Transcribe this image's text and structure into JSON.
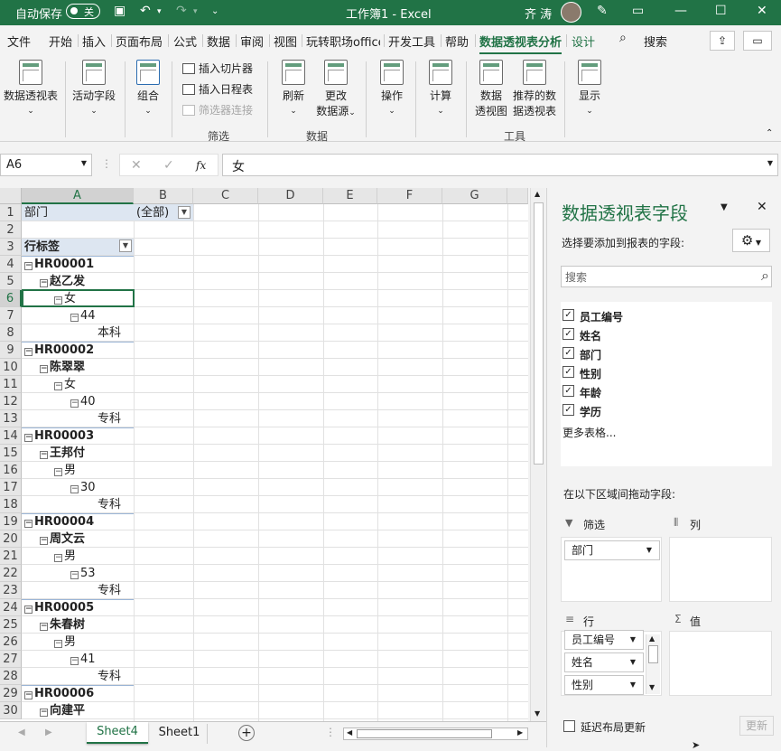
{
  "titlebar": {
    "autosave_label": "自动保存",
    "autosave_state": "关",
    "doc_title": "工作簿1  -  Excel",
    "user_name": "齐 涛"
  },
  "tabs": [
    "文件",
    "开始",
    "插入",
    "页面布局",
    "公式",
    "数据",
    "审阅",
    "视图",
    "玩转职场office",
    "开发工具",
    "帮助",
    "数据透视表分析",
    "设计"
  ],
  "search_label": "搜索",
  "ribbon": {
    "pivot": "数据透视表",
    "active_field": "活动字段",
    "group": "组合",
    "insert_slicer": "插入切片器",
    "insert_timeline": "插入日程表",
    "filter_conn": "筛选器连接",
    "filter_group": "筛选",
    "refresh": "刷新",
    "change_src_1": "更改",
    "change_src_2": "数据源",
    "data_group": "数据",
    "actions": "操作",
    "calc": "计算",
    "pivotchart_1": "数据",
    "pivotchart_2": "透视图",
    "recommended_1": "推荐的数",
    "recommended_2": "据透视表",
    "tools_group": "工具",
    "show": "显示"
  },
  "formula_bar": {
    "name_box": "A6",
    "fx": "fx",
    "value": "女"
  },
  "columns": [
    "A",
    "B",
    "C",
    "D",
    "E",
    "F",
    "G"
  ],
  "rows": [
    {
      "n": "1",
      "a": "部门",
      "b": "(全部)"
    },
    {
      "n": "2",
      "a": ""
    },
    {
      "n": "3",
      "a": "行标签"
    },
    {
      "n": "4",
      "a": "HR00001",
      "lvl": 0
    },
    {
      "n": "5",
      "a": "赵乙发",
      "lvl": 1
    },
    {
      "n": "6",
      "a": "女",
      "lvl": 2
    },
    {
      "n": "7",
      "a": "44",
      "lvl": 3
    },
    {
      "n": "8",
      "a": "本科",
      "lvl": 4
    },
    {
      "n": "9",
      "a": "HR00002",
      "lvl": 0
    },
    {
      "n": "10",
      "a": "陈翠翠",
      "lvl": 1
    },
    {
      "n": "11",
      "a": "女",
      "lvl": 2
    },
    {
      "n": "12",
      "a": "40",
      "lvl": 3
    },
    {
      "n": "13",
      "a": "专科",
      "lvl": 4
    },
    {
      "n": "14",
      "a": "HR00003",
      "lvl": 0
    },
    {
      "n": "15",
      "a": "王邦付",
      "lvl": 1
    },
    {
      "n": "16",
      "a": "男",
      "lvl": 2
    },
    {
      "n": "17",
      "a": "30",
      "lvl": 3
    },
    {
      "n": "18",
      "a": "专科",
      "lvl": 4
    },
    {
      "n": "19",
      "a": "HR00004",
      "lvl": 0
    },
    {
      "n": "20",
      "a": "周文云",
      "lvl": 1
    },
    {
      "n": "21",
      "a": "男",
      "lvl": 2
    },
    {
      "n": "22",
      "a": "53",
      "lvl": 3
    },
    {
      "n": "23",
      "a": "专科",
      "lvl": 4
    },
    {
      "n": "24",
      "a": "HR00005",
      "lvl": 0
    },
    {
      "n": "25",
      "a": "朱春树",
      "lvl": 1
    },
    {
      "n": "26",
      "a": "男",
      "lvl": 2
    },
    {
      "n": "27",
      "a": "41",
      "lvl": 3
    },
    {
      "n": "28",
      "a": "专科",
      "lvl": 4
    },
    {
      "n": "29",
      "a": "HR00006",
      "lvl": 0
    },
    {
      "n": "30",
      "a": "向建平",
      "lvl": 1
    }
  ],
  "sheets": [
    "Sheet4",
    "Sheet1"
  ],
  "pane": {
    "title": "数据透视表字段",
    "choose_label": "选择要添加到报表的字段:",
    "search_placeholder": "搜索",
    "fields": [
      "员工编号",
      "姓名",
      "部门",
      "性别",
      "年龄",
      "学历"
    ],
    "more_tables": "更多表格...",
    "drag_label": "在以下区域间拖动字段:",
    "filters_label": "筛选",
    "columns_label": "列",
    "rows_label": "行",
    "values_label": "值",
    "filter_chips": [
      "部门"
    ],
    "row_chips": [
      "员工编号",
      "姓名",
      "性别"
    ],
    "defer_label": "延迟布局更新",
    "update_btn": "更新"
  }
}
